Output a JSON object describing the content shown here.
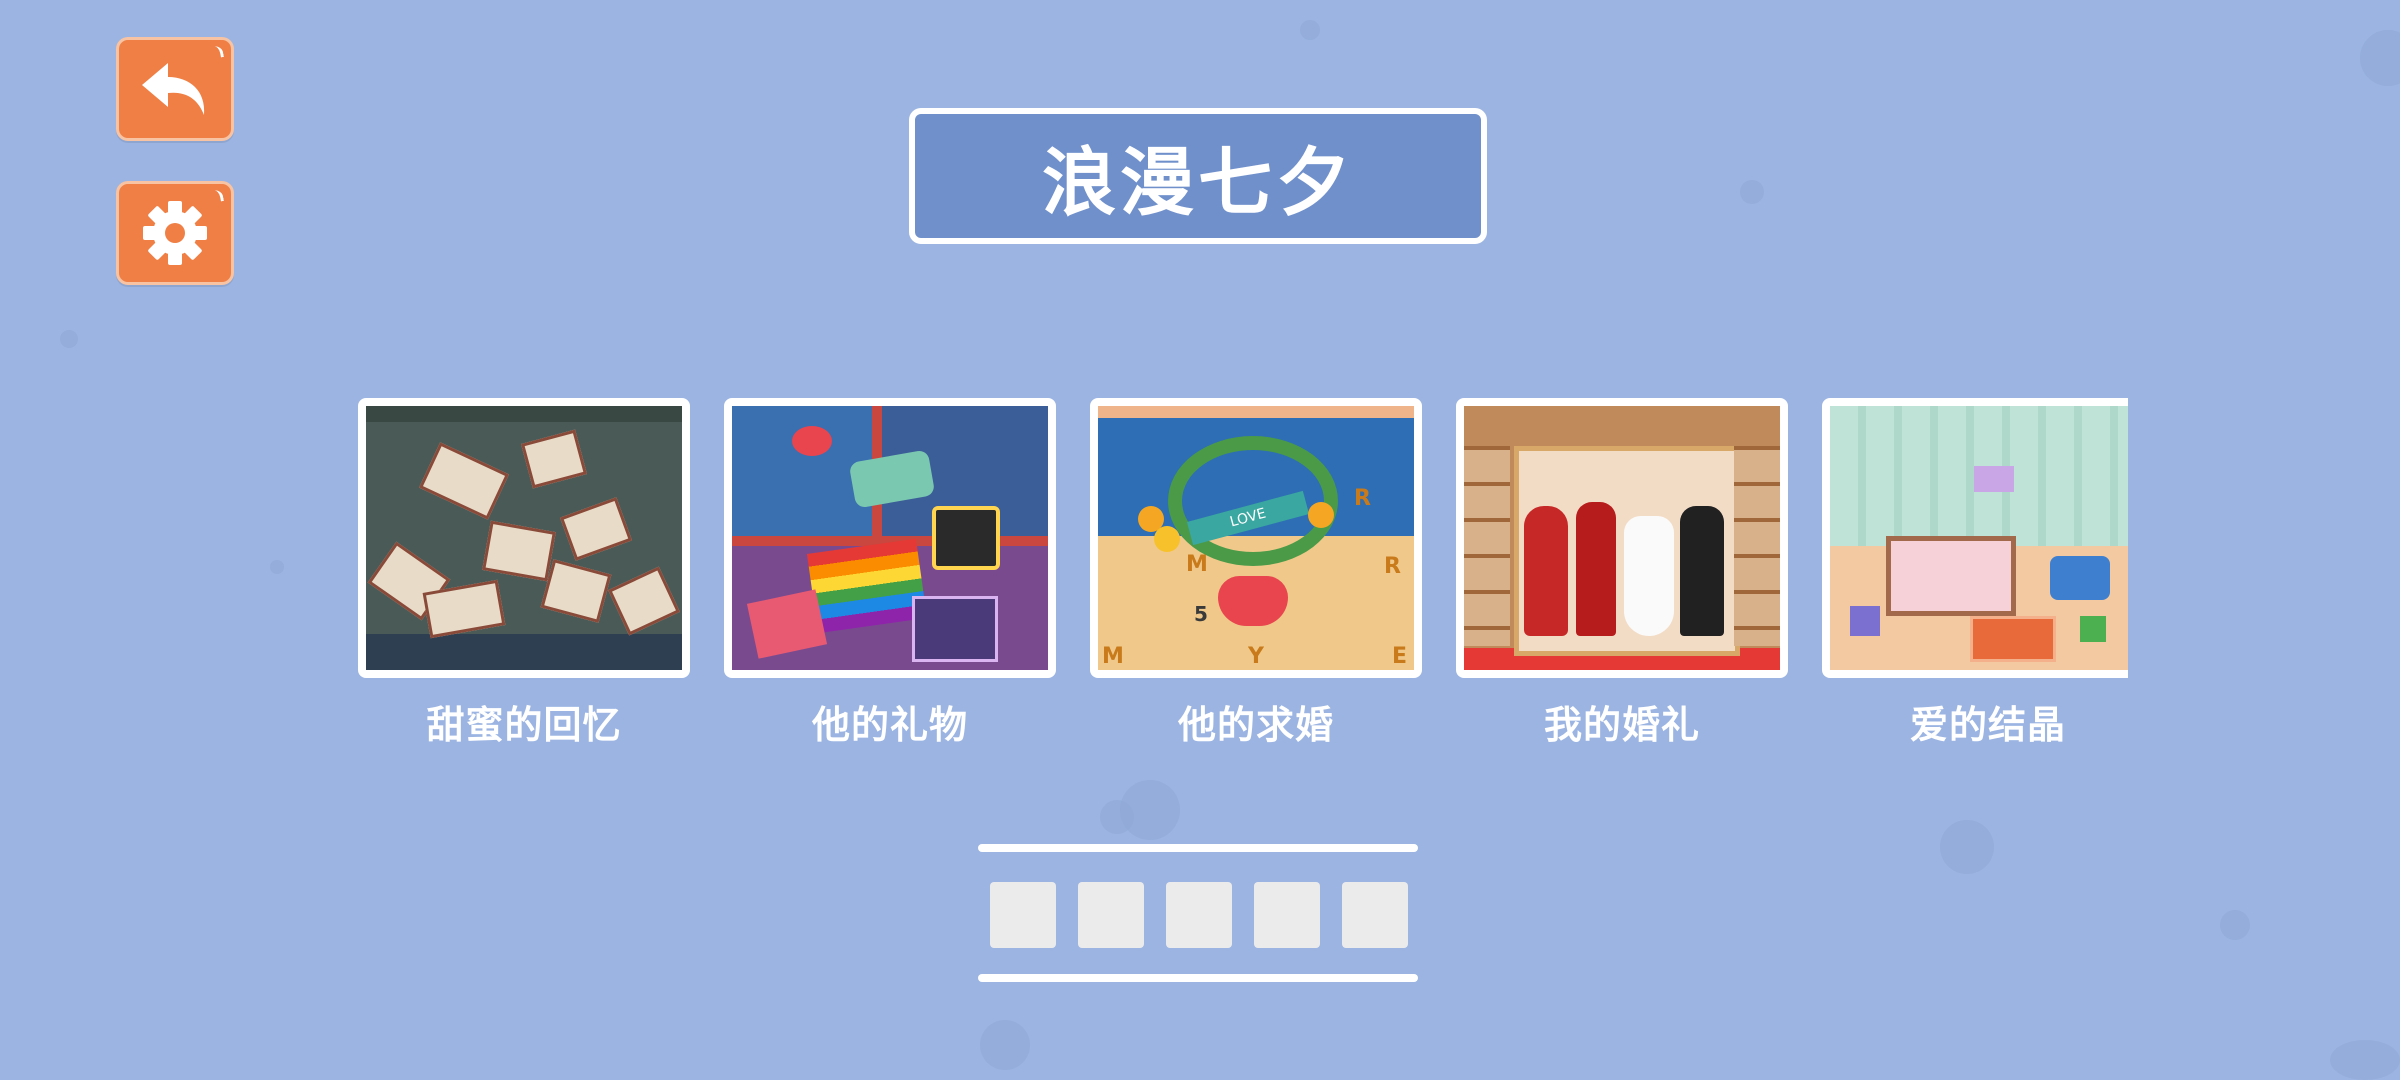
{
  "title": "浪漫七夕",
  "buttons": {
    "back_icon": "back-arrow-icon",
    "settings_icon": "gear-icon"
  },
  "levels": [
    {
      "label": "甜蜜的回忆"
    },
    {
      "label": "他的礼物"
    },
    {
      "label": "他的求婚",
      "thumb_letters": [
        "M",
        "R",
        "R",
        "5",
        "M",
        "Y",
        "E"
      ],
      "banner_text": "LOVE"
    },
    {
      "label": "我的婚礼"
    },
    {
      "label": "爱的结晶"
    }
  ],
  "pager": {
    "total_pages": 5
  },
  "colors": {
    "background": "#9bb4e2",
    "title_panel": "#7090cc",
    "button_orange": "#ef7f45"
  }
}
